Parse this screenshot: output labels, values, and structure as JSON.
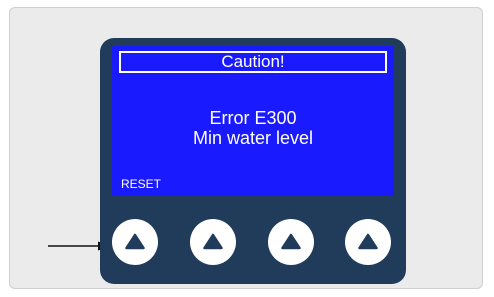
{
  "display": {
    "header": "Caution!",
    "error_code": "Error E300",
    "error_message": "Min water level",
    "soft_key_label": "RESET"
  },
  "buttons": [
    {
      "icon": "triangle-up-icon"
    },
    {
      "icon": "triangle-up-icon"
    },
    {
      "icon": "triangle-up-icon"
    },
    {
      "icon": "triangle-up-icon"
    }
  ],
  "pointer": {
    "icon": "arrow-right-icon"
  },
  "colors": {
    "screen": "#1a1aff",
    "device_body": "#213b5a",
    "button": "#ffffff",
    "button_icon": "#213b5a"
  }
}
